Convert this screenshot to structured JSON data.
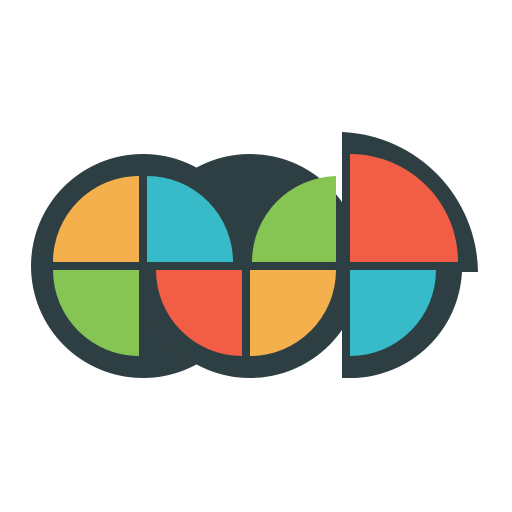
{
  "logo": {
    "description_text": "",
    "colors": {
      "background": "#FFFFFF",
      "outline": "#2E3F43",
      "orange": "#F5B04E",
      "teal": "#37BBC8",
      "green": "#86C454",
      "red": "#F15E45"
    }
  }
}
